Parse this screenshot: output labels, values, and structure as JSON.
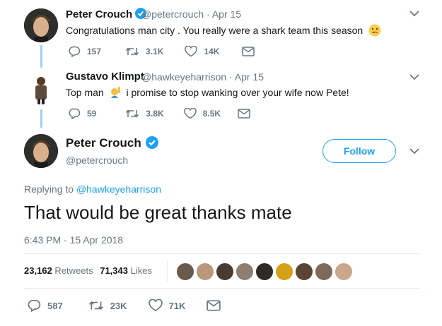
{
  "tweets": [
    {
      "name": "Peter Crouch",
      "handle": "@petercrouch",
      "sep": "·",
      "date": "Apr 15",
      "text": "Congratulations man city . You really were a shark team this season",
      "emoji": "confused-face-emoji",
      "replies": "157",
      "retweets": "3.1K",
      "likes": "14K"
    },
    {
      "name": "Gustavo Klimpt",
      "handle": "@hawkeyeharrison",
      "sep": "·",
      "date": "Apr 15",
      "text_before": "Top man",
      "emoji": "raising-hand-emoji",
      "text_after": "i promise to stop wanking over your wife now Pete!",
      "replies": "59",
      "retweets": "3.8K",
      "likes": "8.5K"
    }
  ],
  "main": {
    "name": "Peter Crouch",
    "handle": "@petercrouch",
    "follow_label": "Follow",
    "replying_prefix": "Replying to",
    "replying_handle": "@hawkeyeharrison",
    "text": "That would be great thanks mate",
    "timestamp": "6:43 PM - 15 Apr 2018",
    "retweets_count": "23,162",
    "retweets_label": "Retweets",
    "likes_count": "71,343",
    "likes_label": "Likes",
    "replies": "587",
    "retweets": "23K",
    "likes": "71K"
  },
  "likers": [
    "#6b5a4e",
    "#b8977a",
    "#4a3b32",
    "#8f7f72",
    "#2f2a28",
    "#d4a017",
    "#5b4636",
    "#7d6a5c",
    "#caa68a"
  ],
  "colors": {
    "accent": "#1da1f2",
    "thread": "#9fd1f5",
    "muted": "#657786"
  }
}
